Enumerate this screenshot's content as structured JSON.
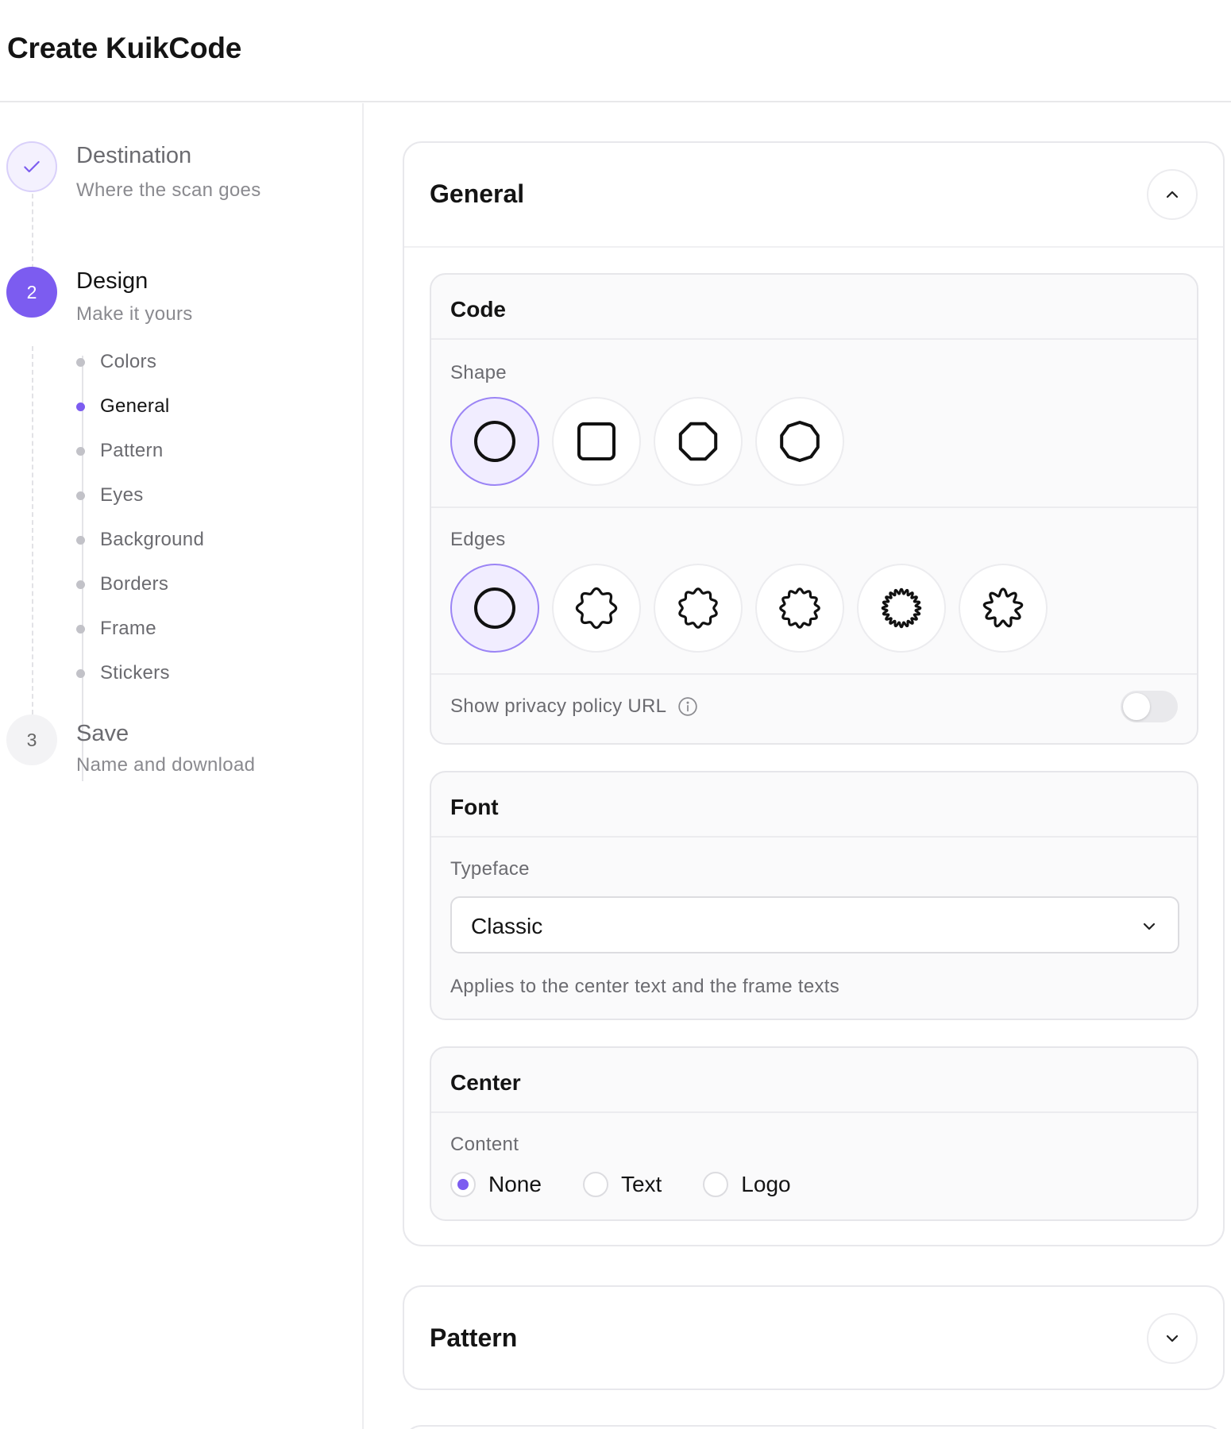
{
  "page": {
    "title": "Create KuikCode"
  },
  "steps": [
    {
      "number": "",
      "title": "Destination",
      "subtitle": "Where the scan goes",
      "state": "done"
    },
    {
      "number": "2",
      "title": "Design",
      "subtitle": "Make it yours",
      "state": "active"
    },
    {
      "number": "3",
      "title": "Save",
      "subtitle": "Name and download",
      "state": "todo"
    }
  ],
  "design_subitems": [
    "Colors",
    "General",
    "Pattern",
    "Eyes",
    "Background",
    "Borders",
    "Frame",
    "Stickers"
  ],
  "design_active_subitem": "General",
  "general": {
    "title": "General",
    "code": {
      "title": "Code",
      "shape_label": "Shape",
      "shape_options": [
        "circle",
        "square",
        "octagon",
        "decagon"
      ],
      "shape_selected": "circle",
      "edges_label": "Edges",
      "edge_options": [
        "smooth",
        "wavy-8",
        "wavy-10",
        "wavy-12",
        "spiky",
        "flower"
      ],
      "edge_selected": "smooth",
      "privacy_label": "Show privacy policy URL",
      "privacy_enabled": false
    },
    "font": {
      "title": "Font",
      "typeface_label": "Typeface",
      "typeface_value": "Classic",
      "hint": "Applies to the center text and the frame texts"
    },
    "center": {
      "title": "Center",
      "content_label": "Content",
      "options": [
        "None",
        "Text",
        "Logo"
      ],
      "selected": "None"
    }
  },
  "pattern": {
    "title": "Pattern"
  },
  "colors": {
    "accent": "#7c5cf0",
    "accent_light": "#f1edff"
  }
}
